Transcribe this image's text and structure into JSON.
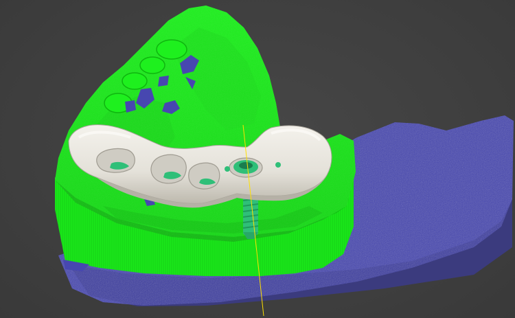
{
  "viewport": {
    "background": "#404040",
    "colors": {
      "bone": "#4747b0",
      "bone_dark": "#34348e",
      "gingiva_model": "#1ef01e",
      "gingiva_shadow": "#10b810",
      "bridge": "#e9e6df",
      "bridge_shadow": "#b9b5ab",
      "implant": "#2fbf78",
      "axis_line": "#ffe000"
    }
  },
  "scene": {
    "objects": [
      {
        "id": "jaw-bone",
        "icon": "bone-mesh"
      },
      {
        "id": "dental-model",
        "icon": "gingiva-mesh"
      },
      {
        "id": "bridge-framework",
        "icon": "implant-bridge"
      },
      {
        "id": "implant-fixture",
        "icon": "dental-implant"
      },
      {
        "id": "implant-axis",
        "icon": "axis-line"
      }
    ]
  }
}
